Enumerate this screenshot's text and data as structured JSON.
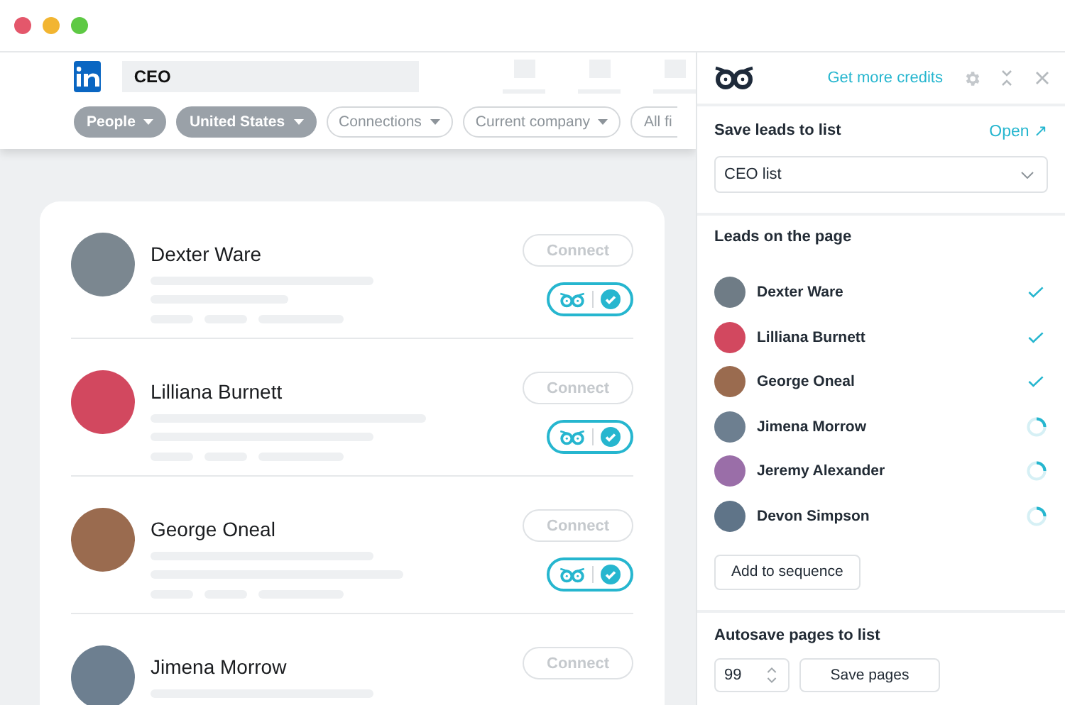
{
  "search": {
    "value": "CEO"
  },
  "filters": [
    {
      "label": "People",
      "selected": true
    },
    {
      "label": "United States",
      "selected": true
    },
    {
      "label": "Connections",
      "selected": false
    },
    {
      "label": "Current company",
      "selected": false
    },
    {
      "label": "All fi",
      "selected": false
    }
  ],
  "results": [
    {
      "name": "Dexter Ware",
      "button": "Connect",
      "saved": true,
      "color": "#7b8790"
    },
    {
      "name": "Lilliana Burnett",
      "button": "Connect",
      "saved": true,
      "color": "#d2485f"
    },
    {
      "name": "George Oneal",
      "button": "Connect",
      "saved": true,
      "color": "#9a6b4f"
    },
    {
      "name": "Jimena Morrow",
      "button": "Connect",
      "saved": false,
      "color": "#6d7f90"
    }
  ],
  "panel": {
    "credits_link": "Get more credits",
    "save_section": {
      "title": "Save leads to list",
      "open_link": "Open ↗",
      "list": "CEO list"
    },
    "leads_section": {
      "title": "Leads on the page",
      "button": "Add to sequence",
      "leads": [
        {
          "name": "Dexter Ware",
          "saved": true,
          "color": "#6f7c86"
        },
        {
          "name": "Lilliana Burnett",
          "saved": true,
          "color": "#d2485f"
        },
        {
          "name": "George Oneal",
          "saved": true,
          "color": "#9a6b4f"
        },
        {
          "name": "Jimena Morrow",
          "saved": false,
          "color": "#6d7f90"
        },
        {
          "name": "Jeremy Alexander",
          "saved": false,
          "color": "#9a6ea8"
        },
        {
          "name": "Devon Simpson",
          "saved": false,
          "color": "#5f7488"
        }
      ]
    },
    "autosave_section": {
      "title": "Autosave pages to list",
      "pages": "99",
      "button": "Save pages"
    }
  }
}
